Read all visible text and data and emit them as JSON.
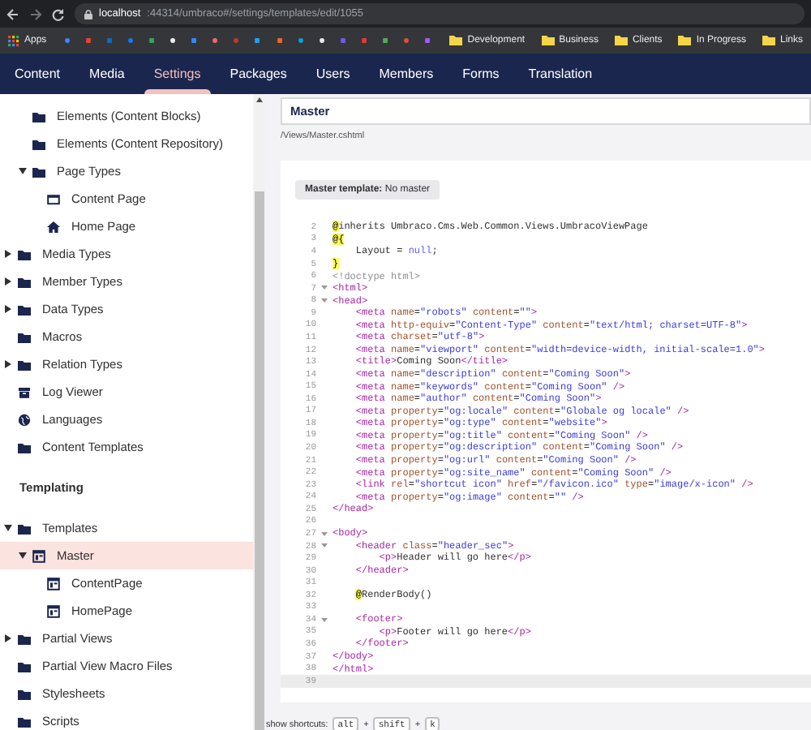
{
  "browser": {
    "url_host": "localhost",
    "url_path": ":44314/umbraco#/settings/templates/edit/1055",
    "bookmarks": {
      "apps_label": "Apps",
      "favicons": [
        {
          "color": "#4285f4",
          "kind": "circle"
        },
        {
          "color": "#ea4335",
          "kind": "square"
        },
        {
          "color": "#0f6cbd",
          "kind": "square"
        },
        {
          "color": "#1877f2",
          "kind": "circle"
        },
        {
          "color": "#34a853",
          "kind": "square"
        },
        {
          "color": "#f0f0f0",
          "kind": "circle"
        },
        {
          "color": "#2d8cff",
          "kind": "square"
        },
        {
          "color": "#f06a6a",
          "kind": "circle"
        },
        {
          "color": "#c0392b",
          "kind": "circle"
        },
        {
          "color": "#1da1f2",
          "kind": "square"
        },
        {
          "color": "#f26522",
          "kind": "square"
        },
        {
          "color": "#00a3e0",
          "kind": "circle"
        },
        {
          "color": "#e8eaed",
          "kind": "circle"
        },
        {
          "color": "#6c5ce7",
          "kind": "square"
        },
        {
          "color": "#e53935",
          "kind": "square"
        },
        {
          "color": "#4caf50",
          "kind": "square"
        },
        {
          "color": "#e74c3c",
          "kind": "circle"
        },
        {
          "color": "#a259ff",
          "kind": "square"
        }
      ],
      "folders": [
        "Development",
        "Business",
        "Clients",
        "In Progress",
        "Links"
      ]
    }
  },
  "nav": [
    {
      "label": "Content",
      "selected": false
    },
    {
      "label": "Media",
      "selected": false
    },
    {
      "label": "Settings",
      "selected": true
    },
    {
      "label": "Packages",
      "selected": false
    },
    {
      "label": "Users",
      "selected": false
    },
    {
      "label": "Members",
      "selected": false
    },
    {
      "label": "Forms",
      "selected": false
    },
    {
      "label": "Translation",
      "selected": false
    }
  ],
  "sidebar": {
    "nested_items": [
      {
        "label": "Elements (Content Blocks)",
        "kind": "folder",
        "selected": false
      },
      {
        "label": "Elements (Content Repository)",
        "kind": "folder",
        "selected": false
      },
      {
        "label": "Page Types",
        "kind": "folder",
        "selected": false,
        "expanded": true,
        "children": [
          {
            "label": "Content Page",
            "kind": "document",
            "selected": false
          },
          {
            "label": "Home Page",
            "kind": "home",
            "selected": false
          }
        ]
      }
    ],
    "items": [
      {
        "label": "Media Types",
        "kind": "folder",
        "selected": false,
        "expanded": false
      },
      {
        "label": "Member Types",
        "kind": "folder",
        "selected": false,
        "expanded": false
      },
      {
        "label": "Data Types",
        "kind": "folder",
        "selected": false,
        "expanded": false
      },
      {
        "label": "Macros",
        "kind": "folder",
        "selected": false
      },
      {
        "label": "Relation Types",
        "kind": "folder",
        "selected": false,
        "expanded": false
      },
      {
        "label": "Log Viewer",
        "kind": "log",
        "selected": false
      },
      {
        "label": "Languages",
        "kind": "globe",
        "selected": false
      },
      {
        "label": "Content Templates",
        "kind": "folder",
        "selected": false
      }
    ],
    "section_title": "Templating",
    "templating_items": [
      {
        "label": "Templates",
        "kind": "folder",
        "selected": false,
        "expanded": true,
        "children": [
          {
            "label": "Master",
            "kind": "template",
            "selected": true,
            "expanded": true,
            "children": [
              {
                "label": "ContentPage",
                "kind": "template",
                "selected": false
              },
              {
                "label": "HomePage",
                "kind": "template",
                "selected": false
              }
            ]
          }
        ]
      },
      {
        "label": "Partial Views",
        "kind": "folder",
        "selected": false,
        "expanded": false
      },
      {
        "label": "Partial View Macro Files",
        "kind": "folder",
        "selected": false
      },
      {
        "label": "Stylesheets",
        "kind": "folder",
        "selected": false
      },
      {
        "label": "Scripts",
        "kind": "folder",
        "selected": false
      }
    ]
  },
  "editor": {
    "name": "Master",
    "path": "/Views/Master.cshtml",
    "master_template": "**Master template:** No master",
    "lines": [
      {
        "number": "2",
        "foldable": false,
        "active": false,
        "segments": [
          {
            "kind": "razor",
            "text": "@"
          },
          {
            "kind": "plain",
            "text": "inherits Umbraco.Cms.Web.Common.Views.UmbracoViewPage"
          }
        ]
      },
      {
        "number": "3",
        "foldable": false,
        "active": false,
        "segments": [
          {
            "kind": "razor",
            "text": "@{"
          }
        ]
      },
      {
        "number": "4",
        "foldable": false,
        "active": false,
        "segments": [
          {
            "kind": "plain",
            "text": "    Layout = "
          },
          {
            "kind": "keyword",
            "text": "null"
          },
          {
            "kind": "plain",
            "text": ";"
          }
        ]
      },
      {
        "number": "5",
        "foldable": false,
        "active": false,
        "segments": [
          {
            "kind": "razor",
            "text": "}"
          }
        ]
      },
      {
        "number": "6",
        "foldable": false,
        "active": false,
        "segments": [
          {
            "kind": "meta",
            "text": "<!doctype html>"
          }
        ]
      },
      {
        "number": "7",
        "foldable": true,
        "active": false,
        "segments": [
          {
            "kind": "tag",
            "text": "<html>"
          }
        ]
      },
      {
        "number": "8",
        "foldable": true,
        "active": false,
        "segments": [
          {
            "kind": "tag",
            "text": "<head>"
          }
        ]
      },
      {
        "number": "9",
        "foldable": false,
        "active": false,
        "segments": [
          {
            "kind": "tag",
            "text": "    <meta "
          },
          {
            "kind": "attr",
            "text": "name"
          },
          {
            "kind": "plain",
            "text": "="
          },
          {
            "kind": "string",
            "text": "\"robots\" "
          },
          {
            "kind": "attr",
            "text": "content"
          },
          {
            "kind": "plain",
            "text": "="
          },
          {
            "kind": "string",
            "text": "\"\""
          },
          {
            "kind": "tag",
            "text": ">"
          }
        ]
      },
      {
        "number": "10",
        "foldable": false,
        "active": false,
        "segments": [
          {
            "kind": "tag",
            "text": "    <meta "
          },
          {
            "kind": "attr",
            "text": "http-equiv"
          },
          {
            "kind": "plain",
            "text": "="
          },
          {
            "kind": "string",
            "text": "\"Content-Type\" "
          },
          {
            "kind": "attr",
            "text": "content"
          },
          {
            "kind": "plain",
            "text": "="
          },
          {
            "kind": "string",
            "text": "\"text/html; charset=UTF-8\""
          },
          {
            "kind": "tag",
            "text": ">"
          }
        ]
      },
      {
        "number": "11",
        "foldable": false,
        "active": false,
        "segments": [
          {
            "kind": "tag",
            "text": "    <meta "
          },
          {
            "kind": "attr",
            "text": "charset"
          },
          {
            "kind": "plain",
            "text": "="
          },
          {
            "kind": "string",
            "text": "\"utf-8\""
          },
          {
            "kind": "tag",
            "text": ">"
          }
        ]
      },
      {
        "number": "12",
        "foldable": false,
        "active": false,
        "segments": [
          {
            "kind": "tag",
            "text": "    <meta "
          },
          {
            "kind": "attr",
            "text": "name"
          },
          {
            "kind": "plain",
            "text": "="
          },
          {
            "kind": "string",
            "text": "\"viewport\" "
          },
          {
            "kind": "attr",
            "text": "content"
          },
          {
            "kind": "plain",
            "text": "="
          },
          {
            "kind": "string",
            "text": "\"width=device-width, initial-scale=1.0\""
          },
          {
            "kind": "tag",
            "text": ">"
          }
        ]
      },
      {
        "number": "13",
        "foldable": false,
        "active": false,
        "segments": [
          {
            "kind": "tag",
            "text": "    <title>"
          },
          {
            "kind": "plain",
            "text": "Coming Soon"
          },
          {
            "kind": "tag",
            "text": "</title>"
          }
        ]
      },
      {
        "number": "14",
        "foldable": false,
        "active": false,
        "segments": [
          {
            "kind": "tag",
            "text": "    <meta "
          },
          {
            "kind": "attr",
            "text": "name"
          },
          {
            "kind": "plain",
            "text": "="
          },
          {
            "kind": "string",
            "text": "\"description\" "
          },
          {
            "kind": "attr",
            "text": "content"
          },
          {
            "kind": "plain",
            "text": "="
          },
          {
            "kind": "string",
            "text": "\"Coming Soon\""
          },
          {
            "kind": "tag",
            "text": ">"
          }
        ]
      },
      {
        "number": "15",
        "foldable": false,
        "active": false,
        "segments": [
          {
            "kind": "tag",
            "text": "    <meta "
          },
          {
            "kind": "attr",
            "text": "name"
          },
          {
            "kind": "plain",
            "text": "="
          },
          {
            "kind": "string",
            "text": "\"keywords\" "
          },
          {
            "kind": "attr",
            "text": "content"
          },
          {
            "kind": "plain",
            "text": "="
          },
          {
            "kind": "string",
            "text": "\"Coming Soon\""
          },
          {
            "kind": "tag",
            "text": " />"
          }
        ]
      },
      {
        "number": "16",
        "foldable": false,
        "active": false,
        "segments": [
          {
            "kind": "tag",
            "text": "    <meta "
          },
          {
            "kind": "attr",
            "text": "name"
          },
          {
            "kind": "plain",
            "text": "="
          },
          {
            "kind": "string",
            "text": "\"author\" "
          },
          {
            "kind": "attr",
            "text": "content"
          },
          {
            "kind": "plain",
            "text": "="
          },
          {
            "kind": "string",
            "text": "\"Coming Soon\""
          },
          {
            "kind": "tag",
            "text": ">"
          }
        ]
      },
      {
        "number": "17",
        "foldable": false,
        "active": false,
        "segments": [
          {
            "kind": "tag",
            "text": "    <meta "
          },
          {
            "kind": "attr",
            "text": "property"
          },
          {
            "kind": "plain",
            "text": "="
          },
          {
            "kind": "string",
            "text": "\"og:locale\" "
          },
          {
            "kind": "attr",
            "text": "content"
          },
          {
            "kind": "plain",
            "text": "="
          },
          {
            "kind": "string",
            "text": "\"Globale og locale\""
          },
          {
            "kind": "tag",
            "text": " />"
          }
        ]
      },
      {
        "number": "18",
        "foldable": false,
        "active": false,
        "segments": [
          {
            "kind": "tag",
            "text": "    <meta "
          },
          {
            "kind": "attr",
            "text": "property"
          },
          {
            "kind": "plain",
            "text": "="
          },
          {
            "kind": "string",
            "text": "\"og:type\" "
          },
          {
            "kind": "attr",
            "text": "content"
          },
          {
            "kind": "plain",
            "text": "="
          },
          {
            "kind": "string",
            "text": "\"website\""
          },
          {
            "kind": "tag",
            "text": ">"
          }
        ]
      },
      {
        "number": "19",
        "foldable": false,
        "active": false,
        "segments": [
          {
            "kind": "tag",
            "text": "    <meta "
          },
          {
            "kind": "attr",
            "text": "property"
          },
          {
            "kind": "plain",
            "text": "="
          },
          {
            "kind": "string",
            "text": "\"og:title\" "
          },
          {
            "kind": "attr",
            "text": "content"
          },
          {
            "kind": "plain",
            "text": "="
          },
          {
            "kind": "string",
            "text": "\"Coming Soon\""
          },
          {
            "kind": "tag",
            "text": " />"
          }
        ]
      },
      {
        "number": "20",
        "foldable": false,
        "active": false,
        "segments": [
          {
            "kind": "tag",
            "text": "    <meta "
          },
          {
            "kind": "attr",
            "text": "property"
          },
          {
            "kind": "plain",
            "text": "="
          },
          {
            "kind": "string",
            "text": "\"og:description\" "
          },
          {
            "kind": "attr",
            "text": "content"
          },
          {
            "kind": "plain",
            "text": "="
          },
          {
            "kind": "string",
            "text": "\"Coming Soon\""
          },
          {
            "kind": "tag",
            "text": " />"
          }
        ]
      },
      {
        "number": "21",
        "foldable": false,
        "active": false,
        "segments": [
          {
            "kind": "tag",
            "text": "    <meta "
          },
          {
            "kind": "attr",
            "text": "property"
          },
          {
            "kind": "plain",
            "text": "="
          },
          {
            "kind": "string",
            "text": "\"og:url\" "
          },
          {
            "kind": "attr",
            "text": "content"
          },
          {
            "kind": "plain",
            "text": "="
          },
          {
            "kind": "string",
            "text": "\"Coming Soon\""
          },
          {
            "kind": "tag",
            "text": " />"
          }
        ]
      },
      {
        "number": "22",
        "foldable": false,
        "active": false,
        "segments": [
          {
            "kind": "tag",
            "text": "    <meta "
          },
          {
            "kind": "attr",
            "text": "property"
          },
          {
            "kind": "plain",
            "text": "="
          },
          {
            "kind": "string",
            "text": "\"og:site_name\" "
          },
          {
            "kind": "attr",
            "text": "content"
          },
          {
            "kind": "plain",
            "text": "="
          },
          {
            "kind": "string",
            "text": "\"Coming Soon\""
          },
          {
            "kind": "tag",
            "text": " />"
          }
        ]
      },
      {
        "number": "23",
        "foldable": false,
        "active": false,
        "segments": [
          {
            "kind": "tag",
            "text": "    <link "
          },
          {
            "kind": "attr",
            "text": "rel"
          },
          {
            "kind": "plain",
            "text": "="
          },
          {
            "kind": "string",
            "text": "\"shortcut icon\" "
          },
          {
            "kind": "attr",
            "text": "href"
          },
          {
            "kind": "plain",
            "text": "="
          },
          {
            "kind": "string",
            "text": "\"/favicon.ico\" "
          },
          {
            "kind": "attr",
            "text": "type"
          },
          {
            "kind": "plain",
            "text": "="
          },
          {
            "kind": "string",
            "text": "\"image/x-icon\""
          },
          {
            "kind": "tag",
            "text": " />"
          }
        ]
      },
      {
        "number": "24",
        "foldable": false,
        "active": false,
        "segments": [
          {
            "kind": "tag",
            "text": "    <meta "
          },
          {
            "kind": "attr",
            "text": "property"
          },
          {
            "kind": "plain",
            "text": "="
          },
          {
            "kind": "string",
            "text": "\"og:image\" "
          },
          {
            "kind": "attr",
            "text": "content"
          },
          {
            "kind": "plain",
            "text": "="
          },
          {
            "kind": "string",
            "text": "\"\""
          },
          {
            "kind": "tag",
            "text": " />"
          }
        ]
      },
      {
        "number": "25",
        "foldable": false,
        "active": false,
        "segments": [
          {
            "kind": "tag",
            "text": "</head>"
          }
        ]
      },
      {
        "number": "26",
        "foldable": false,
        "active": false
      },
      {
        "number": "27",
        "foldable": true,
        "active": false,
        "segments": [
          {
            "kind": "tag",
            "text": "<body>"
          }
        ]
      },
      {
        "number": "28",
        "foldable": true,
        "active": false,
        "segments": [
          {
            "kind": "tag",
            "text": "    <header "
          },
          {
            "kind": "attr",
            "text": "class"
          },
          {
            "kind": "plain",
            "text": "="
          },
          {
            "kind": "string",
            "text": "\"header_sec\""
          },
          {
            "kind": "tag",
            "text": ">"
          }
        ]
      },
      {
        "number": "29",
        "foldable": false,
        "active": false,
        "segments": [
          {
            "kind": "tag",
            "text": "        <p>"
          },
          {
            "kind": "plain",
            "text": "Header will go here"
          },
          {
            "kind": "tag",
            "text": "</p>"
          }
        ]
      },
      {
        "number": "30",
        "foldable": false,
        "active": false,
        "segments": [
          {
            "kind": "tag",
            "text": "    </header>"
          }
        ]
      },
      {
        "number": "31",
        "foldable": false,
        "active": false
      },
      {
        "number": "32",
        "foldable": false,
        "active": false,
        "segments": [
          {
            "kind": "razor",
            "text": "@"
          },
          {
            "kind": "plain",
            "text": "RenderBody()"
          }
        ],
        "indented": true
      },
      {
        "number": "33",
        "foldable": false,
        "active": false
      },
      {
        "number": "34",
        "foldable": true,
        "active": false,
        "segments": [
          {
            "kind": "tag",
            "text": "    <footer>"
          }
        ]
      },
      {
        "number": "35",
        "foldable": false,
        "active": false,
        "segments": [
          {
            "kind": "tag",
            "text": "        <p>"
          },
          {
            "kind": "plain",
            "text": "Footer will go here"
          },
          {
            "kind": "tag",
            "text": "</p>"
          }
        ]
      },
      {
        "number": "36",
        "foldable": false,
        "active": false,
        "segments": [
          {
            "kind": "tag",
            "text": "    </footer>"
          }
        ]
      },
      {
        "number": "37",
        "foldable": false,
        "active": false,
        "segments": [
          {
            "kind": "tag",
            "text": "</body>"
          }
        ]
      },
      {
        "number": "38",
        "foldable": false,
        "active": false,
        "segments": [
          {
            "kind": "tag",
            "text": "</html>"
          }
        ]
      },
      {
        "number": "39",
        "foldable": false,
        "active": true
      }
    ],
    "shortcuts": {
      "label": "show shortcuts:",
      "keys": [
        "alt",
        "shift",
        "k"
      ],
      "separator": "+"
    }
  }
}
